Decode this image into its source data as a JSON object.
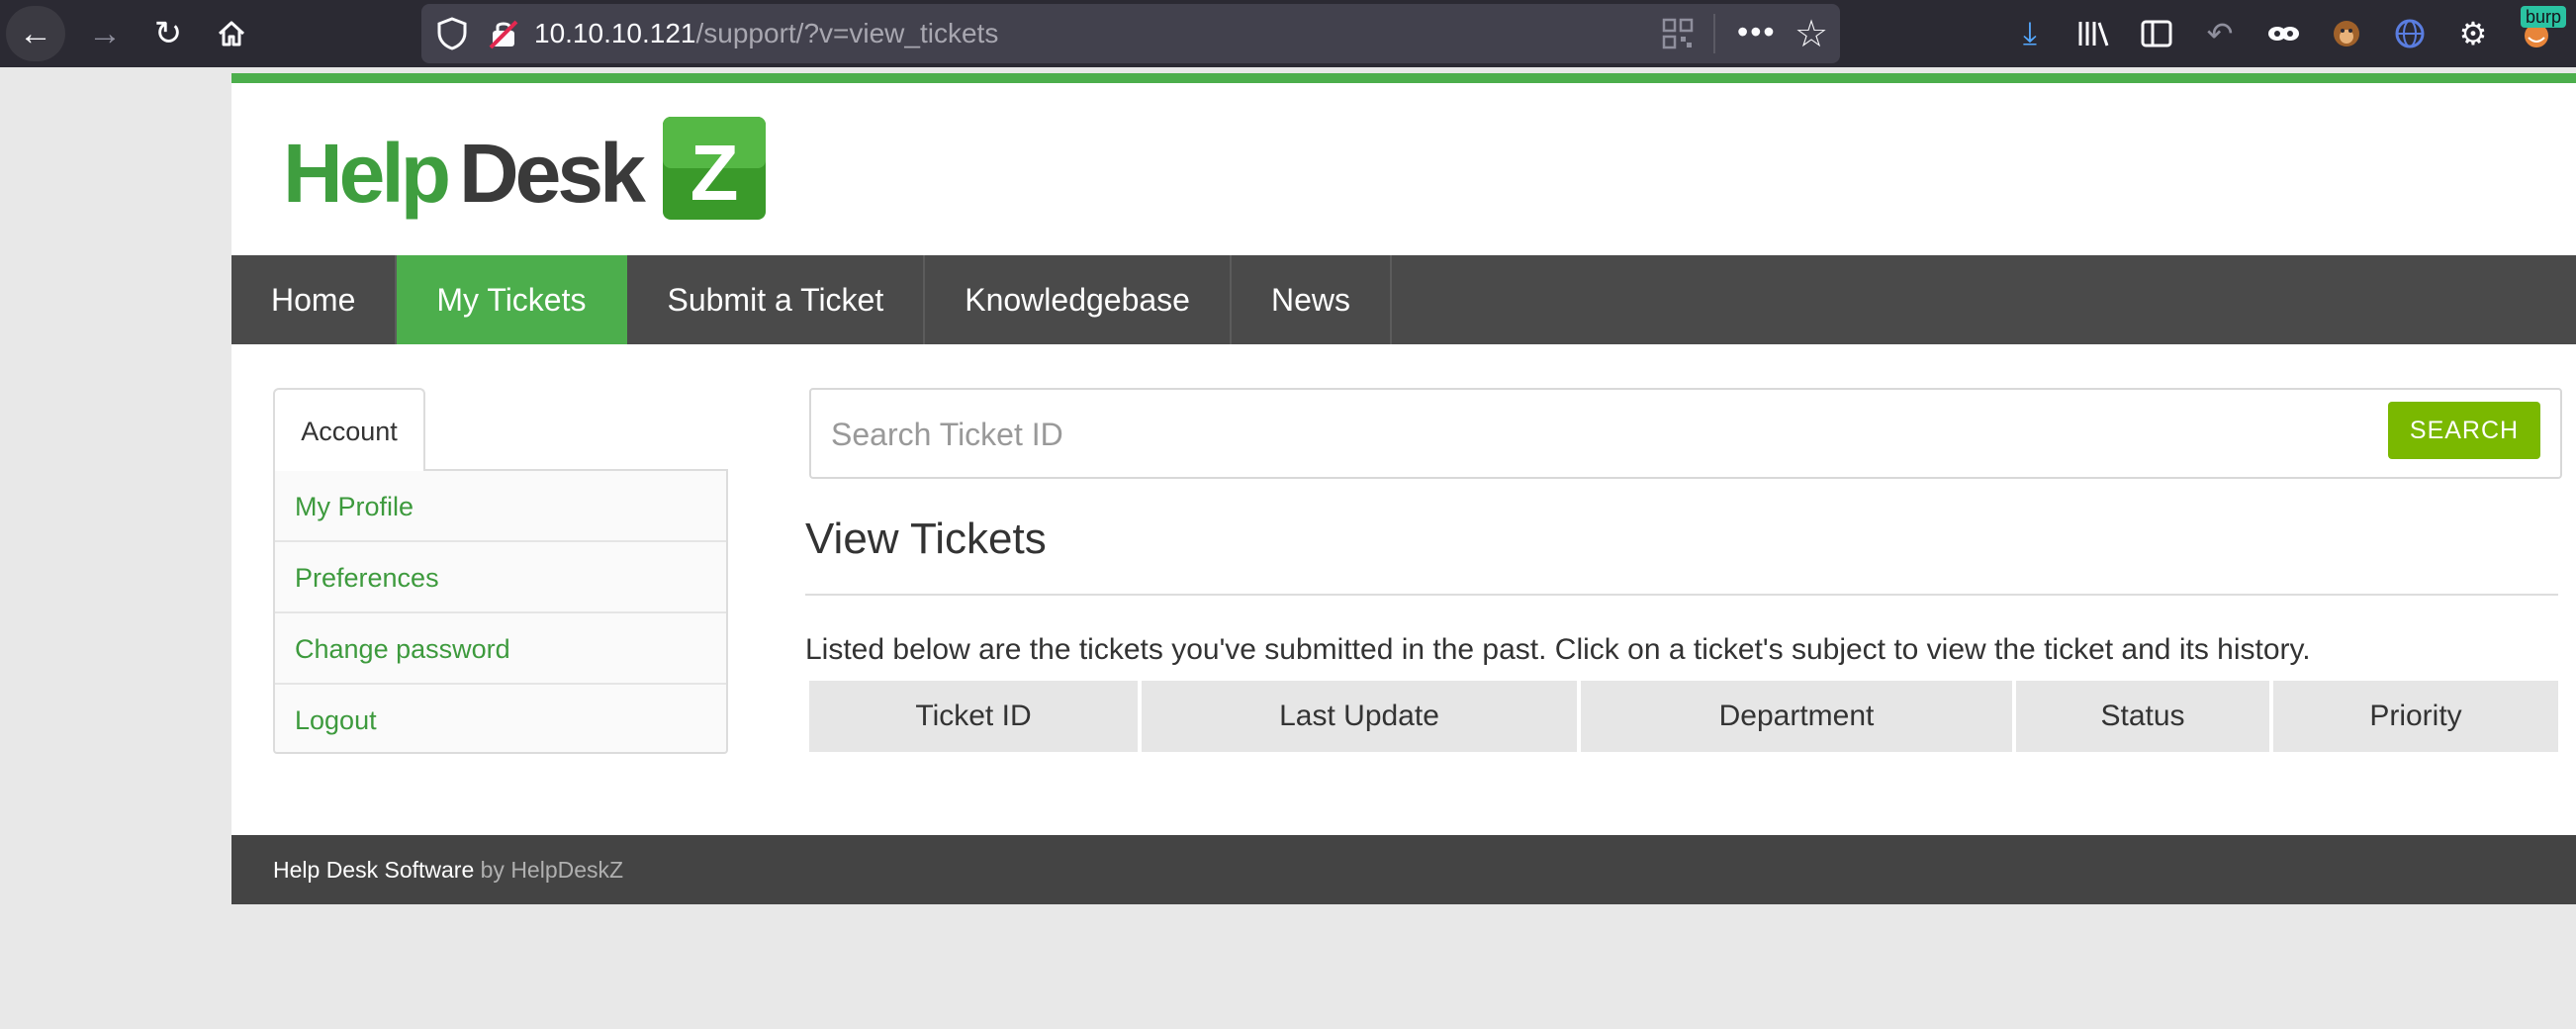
{
  "browser": {
    "url_host": "10.10.10.121",
    "url_path": "/support/?v=view_tickets",
    "burp_badge": "burp"
  },
  "logo": {
    "text_part1": "Help",
    "text_part2": "Desk",
    "text_z": "Z"
  },
  "nav": {
    "items": [
      "Home",
      "My Tickets",
      "Submit a Ticket",
      "Knowledgebase",
      "News"
    ],
    "active": "My Tickets"
  },
  "sidebar": {
    "tab_label": "Account",
    "items": [
      "My Profile",
      "Preferences",
      "Change password",
      "Logout"
    ]
  },
  "search": {
    "placeholder": "Search Ticket ID",
    "button_label": "SEARCH"
  },
  "main": {
    "heading": "View Tickets",
    "description": "Listed below are the tickets you've submitted in the past. Click on a ticket's subject to view the ticket and its history.",
    "columns": [
      "Ticket ID",
      "Last Update",
      "Department",
      "Status",
      "Priority"
    ]
  },
  "footer": {
    "software": "Help Desk Software",
    "by": "by HelpDeskZ"
  },
  "colors": {
    "accent_green": "#4cae4c",
    "search_green": "#7ab800",
    "nav_bg": "#4a4a4a"
  }
}
